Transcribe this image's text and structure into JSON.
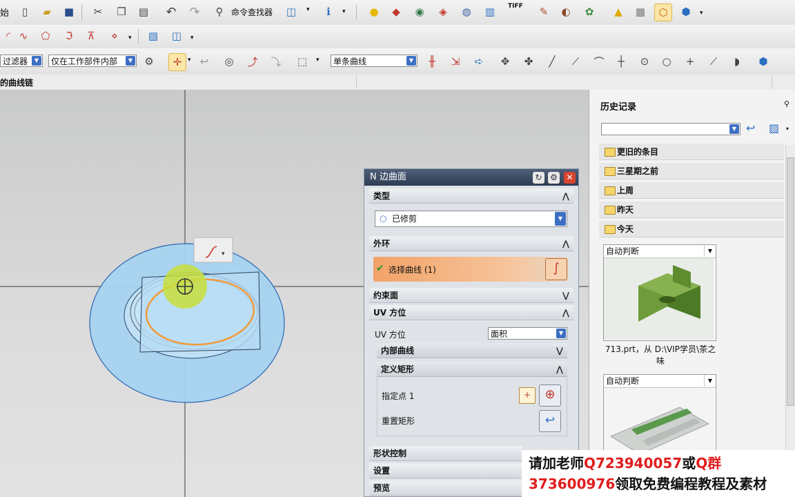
{
  "toolbar1": {
    "left_label": "始",
    "command_finder": "命令查找器",
    "tiff_label": "TIFF"
  },
  "toolbar3": {
    "filter_value": "过滤器",
    "scope_value": "仅在工作部件内部",
    "curve_rule_value": "单条曲线"
  },
  "status": {
    "prompt": "的曲线链"
  },
  "dialog": {
    "title": "N 边曲面",
    "type_group": "类型",
    "type_value": "已修剪",
    "outer_loop_group": "外环",
    "select_curve": "选择曲线 (1)",
    "constraint_group": "约束面",
    "uv_group": "UV 方位",
    "uv_label": "UV 方位",
    "uv_value": "面积",
    "inner_curve": "内部曲线",
    "define_rect": "定义矩形",
    "specify_point": "指定点 1",
    "reset_rect": "重置矩形",
    "shape_control": "形状控制",
    "settings": "设置",
    "preview": "预览"
  },
  "history": {
    "title": "历史记录",
    "items": [
      "更旧的条目",
      "三星期之前",
      "上周",
      "昨天",
      "今天"
    ],
    "thumb1": {
      "mode": "自动判断",
      "caption": "713.prt，从 D:\\VIP学员\\茶之味"
    },
    "thumb2": {
      "mode": "自动判断"
    }
  },
  "watermark": {
    "line1_a": "请加老师",
    "line1_b": "Q723940057",
    "line1_c": "或",
    "line1_d": "Q群",
    "line2_a": "373600976",
    "line2_b": "领取免费编程教程及素材"
  },
  "colors": {
    "dialog_title_bg": "#34435a",
    "select_row": "#f0a267",
    "dish": "#a9d4f2",
    "orange_curve": "#f29a3a"
  }
}
